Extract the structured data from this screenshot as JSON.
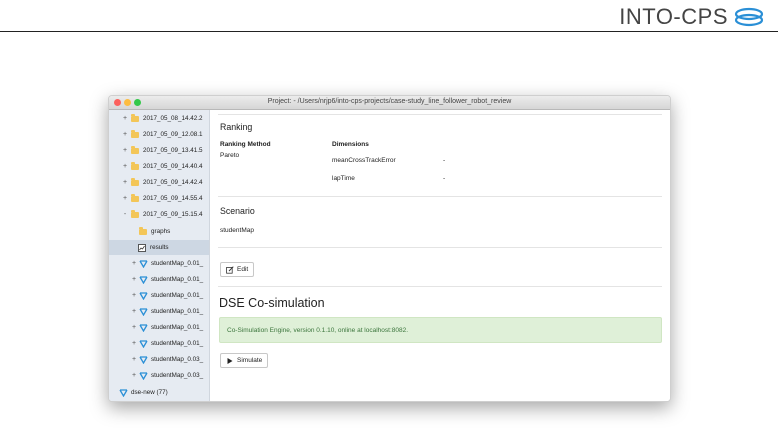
{
  "brand": {
    "name": "INTO-CPS"
  },
  "window": {
    "title": "Project: - /Users/nrjp6/into-cps-projects/case-study_line_follower_robot_review"
  },
  "sidebar": {
    "items": [
      {
        "toggle": "+",
        "icon": "folder-icon",
        "label": "2017_05_08_14.42.2"
      },
      {
        "toggle": "+",
        "icon": "folder-icon",
        "label": "2017_05_09_12.08.1"
      },
      {
        "toggle": "+",
        "icon": "folder-icon",
        "label": "2017_05_09_13.41.5"
      },
      {
        "toggle": "+",
        "icon": "folder-icon",
        "label": "2017_05_09_14.40.4"
      },
      {
        "toggle": "+",
        "icon": "folder-icon",
        "label": "2017_05_09_14.42.4"
      },
      {
        "toggle": "+",
        "icon": "folder-icon",
        "label": "2017_05_09_14.55.4"
      },
      {
        "toggle": "-",
        "icon": "folder-icon",
        "label": "2017_05_09_15.15.4"
      },
      {
        "toggle": "",
        "icon": "folder-icon",
        "label": "graphs"
      },
      {
        "toggle": "",
        "icon": "results-icon",
        "label": "results"
      },
      {
        "toggle": "+",
        "icon": "model-icon",
        "label": "studentMap_0.01_"
      },
      {
        "toggle": "+",
        "icon": "model-icon",
        "label": "studentMap_0.01_"
      },
      {
        "toggle": "+",
        "icon": "model-icon",
        "label": "studentMap_0.01_"
      },
      {
        "toggle": "+",
        "icon": "model-icon",
        "label": "studentMap_0.01_"
      },
      {
        "toggle": "+",
        "icon": "model-icon",
        "label": "studentMap_0.01_"
      },
      {
        "toggle": "+",
        "icon": "model-icon",
        "label": "studentMap_0.01_"
      },
      {
        "toggle": "+",
        "icon": "model-icon",
        "label": "studentMap_0.03_"
      },
      {
        "toggle": "+",
        "icon": "model-icon",
        "label": "studentMap_0.03_"
      },
      {
        "toggle": "",
        "icon": "model-icon",
        "label": "dse-new (77)"
      }
    ]
  },
  "ranking": {
    "title": "Ranking",
    "method_label": "Ranking Method",
    "method_value": "Pareto",
    "dimensions_label": "Dimensions",
    "dimensions": [
      {
        "name": "meanCrossTrackError",
        "value": "-"
      },
      {
        "name": "lapTime",
        "value": "-"
      }
    ]
  },
  "scenario": {
    "title": "Scenario",
    "value": "studentMap"
  },
  "edit_button": {
    "label": "Edit"
  },
  "cosim": {
    "title": "DSE Co-simulation",
    "status": "Co-Simulation Engine, version 0.1.10, online at localhost:8082.",
    "simulate_label": "Simulate"
  },
  "colors": {
    "sidebar_bg": "#e6ebf2",
    "alert_bg": "#dff0d8",
    "alert_text": "#3c763d",
    "model_icon": "#2a8fd6",
    "folder_icon": "#f3c658"
  }
}
